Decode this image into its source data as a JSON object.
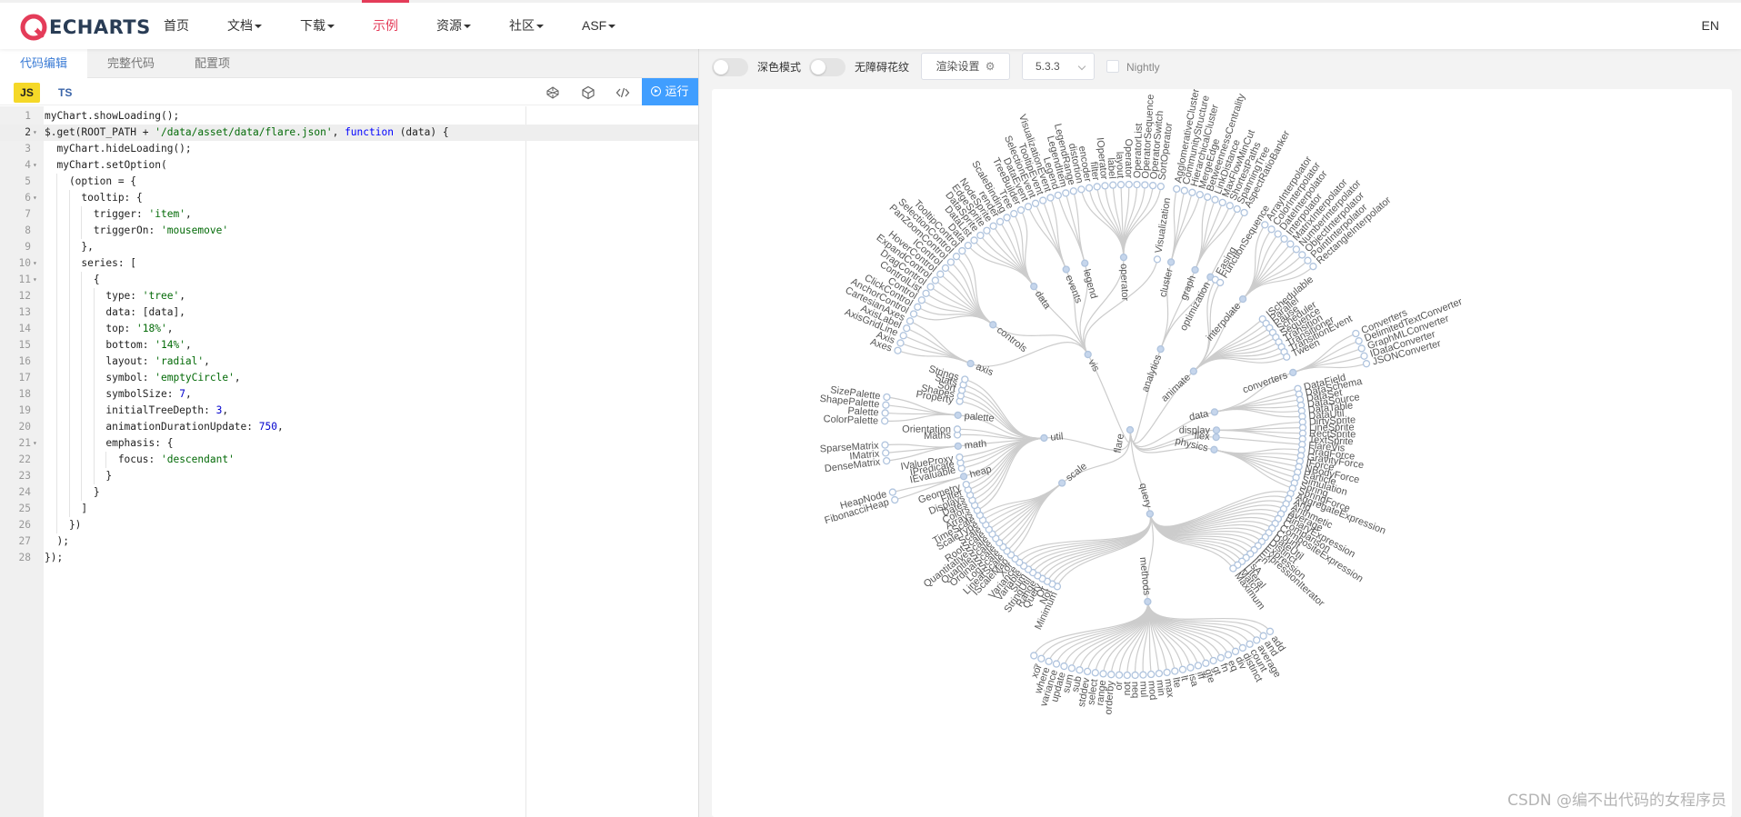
{
  "nav": {
    "brand": "ECHARTS",
    "items": [
      {
        "label": "首页",
        "caret": false,
        "active": false
      },
      {
        "label": "文档",
        "caret": true,
        "active": false
      },
      {
        "label": "下载",
        "caret": true,
        "active": false
      },
      {
        "label": "示例",
        "caret": false,
        "active": true
      },
      {
        "label": "资源",
        "caret": true,
        "active": false
      },
      {
        "label": "社区",
        "caret": true,
        "active": false
      },
      {
        "label": "ASF",
        "caret": true,
        "active": false
      }
    ],
    "lang": "EN"
  },
  "editor": {
    "tabs": [
      "代码编辑",
      "完整代码",
      "配置项"
    ],
    "active_tab": 0,
    "js_label": "JS",
    "ts_label": "TS",
    "run_label": "运行",
    "active_line": 2,
    "lines": [
      "myChart.showLoading();",
      "$.get(ROOT_PATH + '/data/asset/data/flare.json', function (data) {",
      "  myChart.hideLoading();",
      "  myChart.setOption(",
      "    (option = {",
      "      tooltip: {",
      "        trigger: 'item',",
      "        triggerOn: 'mousemove'",
      "      },",
      "      series: [",
      "        {",
      "          type: 'tree',",
      "          data: [data],",
      "          top: '18%',",
      "          bottom: '14%',",
      "          layout: 'radial',",
      "          symbol: 'emptyCircle',",
      "          symbolSize: 7,",
      "          initialTreeDepth: 3,",
      "          animationDurationUpdate: 750,",
      "          emphasis: {",
      "            focus: 'descendant'",
      "          }",
      "        }",
      "      ]",
      "    })",
      "  );",
      "});"
    ],
    "folds": [
      2,
      4,
      6,
      10,
      11,
      21
    ]
  },
  "preview": {
    "dark_mode_label": "深色模式",
    "accessible_label": "无障碍花纹",
    "render_settings_label": "渲染设置",
    "version": "5.3.3",
    "nightly_label": "Nightly",
    "watermark": "CSDN @编不出代码的女程序员"
  },
  "colors": {
    "accent": "#e43c59",
    "run_button": "#409eff",
    "link_line": "#cccccc",
    "node_stroke": "#b0c4de",
    "label": "#555555"
  },
  "chart_data": {
    "type": "tree",
    "layout": "radial",
    "root": "flare",
    "groups": [
      {
        "name": "analytics",
        "children": [
          {
            "name": "cluster",
            "children": [
              "AgglomerativeCluster",
              "CommunityStructure",
              "HierarchicalCluster",
              "MergeEdge"
            ]
          },
          {
            "name": "graph",
            "children": [
              "BetweennessCentrality",
              "LinkDistance",
              "MaxFlowMinCut",
              "ShortestPaths",
              "SpanningTree"
            ]
          },
          {
            "name": "optimization",
            "children": [
              "AspectRatioBanker"
            ]
          }
        ]
      },
      {
        "name": "animate",
        "children": [
          {
            "name": "Easing",
            "children": []
          },
          {
            "name": "FunctionSequence",
            "children": []
          },
          {
            "name": "interpolate",
            "children": [
              "ArrayInterpolator",
              "ColorInterpolator",
              "DateInterpolator",
              "Interpolator",
              "MatrixInterpolator",
              "NumberInterpolator",
              "ObjectInterpolator",
              "PointInterpolator",
              "RectangleInterpolator"
            ]
          },
          {
            "name": "ISchedulable",
            "children": []
          },
          {
            "name": "Parallel",
            "children": []
          },
          {
            "name": "Pause",
            "children": []
          },
          {
            "name": "Scheduler",
            "children": []
          },
          {
            "name": "Sequence",
            "children": []
          },
          {
            "name": "Transition",
            "children": []
          },
          {
            "name": "Transitioner",
            "children": []
          },
          {
            "name": "TransitionEvent",
            "children": []
          },
          {
            "name": "Tween",
            "children": []
          }
        ]
      },
      {
        "name": "data",
        "children": [
          {
            "name": "converters",
            "children": [
              "Converters",
              "DelimitedTextConverter",
              "GraphMLConverter",
              "IDataConverter",
              "JSONConverter"
            ]
          },
          {
            "name": "DataField",
            "children": []
          },
          {
            "name": "DataSchema",
            "children": []
          },
          {
            "name": "DataSet",
            "children": []
          },
          {
            "name": "DataSource",
            "children": []
          },
          {
            "name": "DataTable",
            "children": []
          },
          {
            "name": "DataUtil",
            "children": []
          }
        ]
      },
      {
        "name": "display",
        "children": [
          {
            "name": "DirtySprite",
            "children": []
          },
          {
            "name": "LineSprite",
            "children": []
          },
          {
            "name": "RectSprite",
            "children": []
          },
          {
            "name": "TextSprite",
            "children": []
          }
        ]
      },
      {
        "name": "flex",
        "children": [
          {
            "name": "FlareVis",
            "children": []
          }
        ]
      },
      {
        "name": "physics",
        "children": [
          {
            "name": "DragForce",
            "children": []
          },
          {
            "name": "GravityForce",
            "children": []
          },
          {
            "name": "IForce",
            "children": []
          },
          {
            "name": "NBodyForce",
            "children": []
          },
          {
            "name": "Particle",
            "children": []
          },
          {
            "name": "Simulation",
            "children": []
          },
          {
            "name": "Spring",
            "children": []
          },
          {
            "name": "SpringForce",
            "children": []
          }
        ]
      },
      {
        "name": "query",
        "children": [
          {
            "name": "AggregateExpression",
            "children": []
          },
          {
            "name": "And",
            "children": []
          },
          {
            "name": "Arithmetic",
            "children": []
          },
          {
            "name": "Average",
            "children": []
          },
          {
            "name": "BinaryExpression",
            "children": []
          },
          {
            "name": "Comparison",
            "children": []
          },
          {
            "name": "CompositeExpression",
            "children": []
          },
          {
            "name": "Count",
            "children": []
          },
          {
            "name": "DateUtil",
            "children": []
          },
          {
            "name": "Distinct",
            "children": []
          },
          {
            "name": "Expression",
            "children": []
          },
          {
            "name": "ExpressionIterator",
            "children": []
          },
          {
            "name": "Fn",
            "children": []
          },
          {
            "name": "If",
            "children": []
          },
          {
            "name": "IsA",
            "children": []
          },
          {
            "name": "Literal",
            "children": []
          },
          {
            "name": "Match",
            "children": []
          },
          {
            "name": "Maximum",
            "children": []
          },
          {
            "name": "methods",
            "children": [
              "add",
              "and",
              "average",
              "count",
              "distinct",
              "div",
              "eq",
              "fn",
              "gt",
              "gte",
              "iff",
              "isa",
              "lt",
              "lte",
              "max",
              "min",
              "mod",
              "mul",
              "neq",
              "not",
              "or",
              "orderby",
              "range",
              "select",
              "stddev",
              "sub",
              "sum",
              "update",
              "variance",
              "where",
              "xor",
              "_"
            ]
          },
          {
            "name": "Minimum",
            "children": []
          },
          {
            "name": "Not",
            "children": []
          },
          {
            "name": "Or",
            "children": []
          },
          {
            "name": "Query",
            "children": []
          },
          {
            "name": "Range",
            "children": []
          },
          {
            "name": "StringUtil",
            "children": []
          },
          {
            "name": "Sum",
            "children": []
          },
          {
            "name": "Variable",
            "children": []
          },
          {
            "name": "Variance",
            "children": []
          },
          {
            "name": "Xor",
            "children": []
          }
        ]
      },
      {
        "name": "scale",
        "children": [
          {
            "name": "IScaleMap",
            "children": []
          },
          {
            "name": "LinearScale",
            "children": []
          },
          {
            "name": "LogScale",
            "children": []
          },
          {
            "name": "OrdinalScale",
            "children": []
          },
          {
            "name": "QuantileScale",
            "children": []
          },
          {
            "name": "QuantitativeScale",
            "children": []
          },
          {
            "name": "RootScale",
            "children": []
          },
          {
            "name": "Scale",
            "children": []
          },
          {
            "name": "ScaleType",
            "children": []
          },
          {
            "name": "TimeScale",
            "children": []
          }
        ]
      },
      {
        "name": "util",
        "children": [
          {
            "name": "Arrays",
            "children": []
          },
          {
            "name": "Colors",
            "children": []
          },
          {
            "name": "Dates",
            "children": []
          },
          {
            "name": "Displays",
            "children": []
          },
          {
            "name": "Filter",
            "children": []
          },
          {
            "name": "Geometry",
            "children": []
          },
          {
            "name": "heap",
            "children": [
              "FibonacciHeap",
              "HeapNode"
            ]
          },
          {
            "name": "IEvaluable",
            "children": []
          },
          {
            "name": "IPredicate",
            "children": []
          },
          {
            "name": "IValueProxy",
            "children": []
          },
          {
            "name": "math",
            "children": [
              "DenseMatrix",
              "IMatrix",
              "SparseMatrix"
            ]
          },
          {
            "name": "Maths",
            "children": []
          },
          {
            "name": "Orientation",
            "children": []
          },
          {
            "name": "palette",
            "children": [
              "ColorPalette",
              "Palette",
              "ShapePalette",
              "SizePalette"
            ]
          },
          {
            "name": "Property",
            "children": []
          },
          {
            "name": "Shapes",
            "children": []
          },
          {
            "name": "Sort",
            "children": []
          },
          {
            "name": "Stats",
            "children": []
          },
          {
            "name": "Strings",
            "children": []
          }
        ]
      },
      {
        "name": "vis",
        "children": [
          {
            "name": "axis",
            "children": [
              "Axes",
              "Axis",
              "AxisGridLine",
              "AxisLabel",
              "CartesianAxes"
            ]
          },
          {
            "name": "controls",
            "children": [
              "AnchorControl",
              "ClickControl",
              "Control",
              "ControlList",
              "DragControl",
              "ExpandControl",
              "HoverControl",
              "IControl",
              "PanZoomControl",
              "SelectionControl",
              "TooltipControl"
            ]
          },
          {
            "name": "data",
            "children": [
              "Data",
              "DataList",
              "DataSprite",
              "EdgeSprite",
              "NodeSprite",
              "render",
              "ScaleBinding",
              "Tree",
              "TreeBuilder"
            ]
          },
          {
            "name": "events",
            "children": [
              "DataEvent",
              "SelectionEvent",
              "TooltipEvent",
              "VisualizationEvent"
            ]
          },
          {
            "name": "legend",
            "children": [
              "Legend",
              "LegendItem",
              "LegendRange"
            ]
          },
          {
            "name": "operator",
            "children": [
              "distortion",
              "encoder",
              "filter",
              "IOperator",
              "label",
              "layout",
              "Operator",
              "OperatorList",
              "OperatorSequence",
              "OperatorSwitch",
              "SortOperator"
            ]
          },
          {
            "name": "Visualization",
            "children": []
          }
        ]
      }
    ]
  }
}
